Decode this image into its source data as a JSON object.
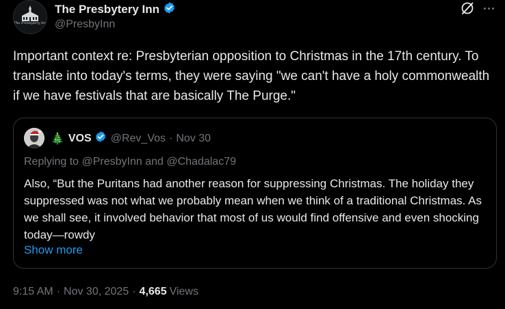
{
  "author": {
    "display_name": "The Presbytery Inn",
    "handle": "@PresbyInn",
    "avatar_caption": "The Presbytery Inn",
    "verified": true
  },
  "post": {
    "text": "Important context re: Presbyterian opposition to Christmas in the 17th century. To translate into today's terms, they were saying \"we can't have a holy commonwealth if we have festivals that are basically The Purge.\""
  },
  "quoted": {
    "tree_emoji": "🎄",
    "display_name": "VOS",
    "handle": "@Rev_Vos",
    "separator": "·",
    "date": "Nov 30",
    "replying_to": "Replying to @PresbyInn and @Chadalac79",
    "text": "Also, “But the Puritans had another reason for suppressing Christmas. The holiday they suppressed was not what we probably mean when we think of a traditional Christmas. As we shall see, it involved behavior that most of us would find offensive and even shocking today—rowdy",
    "show_more": "Show more"
  },
  "meta": {
    "time": "9:15 AM",
    "separator": "·",
    "date": "Nov 30, 2025",
    "views_count": "4,665",
    "views_label": "Views"
  },
  "colors": {
    "background": "#000000",
    "text_primary": "#e7e9ea",
    "text_secondary": "#71767b",
    "accent": "#1d9bf0",
    "border": "#2f3336"
  },
  "icons": [
    "grok-icon",
    "more-icon",
    "verified-badge-icon"
  ]
}
